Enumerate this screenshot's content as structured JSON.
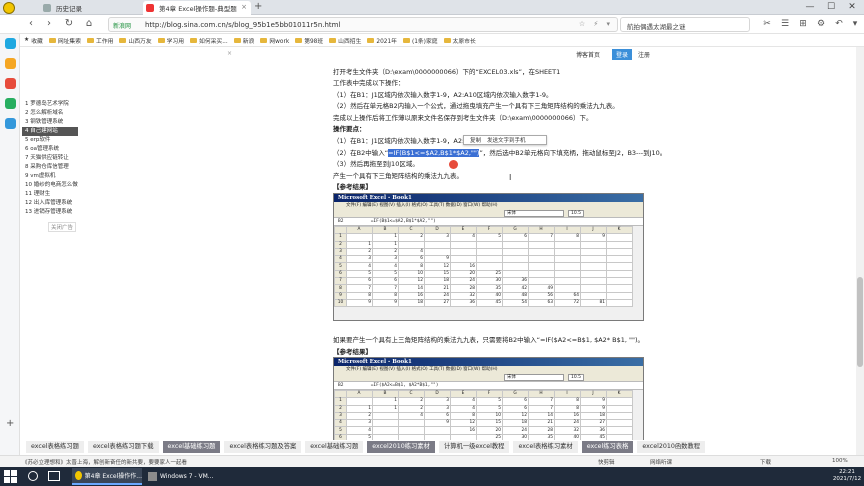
{
  "browser": {
    "tabs": [
      {
        "label": "历史记录",
        "active": false
      },
      {
        "label": "第4章 Excel操作题-典型题解析-...",
        "active": true
      }
    ],
    "new_tab": "+",
    "window_controls": {
      "minimize": "—",
      "maximize": "☐",
      "close": "✕"
    },
    "url": "http://blog.sina.com.cn/s/blog_95b1e5bb01011r5n.html",
    "security_label": "新浪网",
    "search_text": "航拍偶遇太湖最之谜",
    "bookmarks": [
      "收藏",
      "网址集索",
      "工作用",
      "山西万友",
      "学习用",
      "如何采买...",
      "新浪",
      "网work",
      "第98班",
      "山西招生",
      "2021年",
      "(1条)家庭",
      "太原市长"
    ]
  },
  "site_header": {
    "links": [
      "新浪首页",
      "登录",
      "注册"
    ],
    "right_link": "博客首页"
  },
  "sidebar": {
    "items": [
      "1 罗德岛艺术学院",
      "2 怎么解析域名",
      "3 钢铁管理系统",
      "4 自己建网站",
      "5 erp软件",
      "6 oa管理系统",
      "7 天猫供应链转让",
      "8 采购仓库信管理",
      "9 vm虚拟机",
      "10 婚纱的电商怎么做",
      "11 理财生",
      "12 出入库管理系统",
      "13 进销存管理系统"
    ],
    "selected_index": 3,
    "ad_label": "关闭广告"
  },
  "article": {
    "lines": [
      "打开考生文件夹（D:\\exam\\0000000066）下的“EXCEL03.xls”，在SHEET1",
      "工作表中完成以下操作：",
      "（1）在B1：J1区域内依次输入数字1-9，A2:A10区域内依次输入数字1-9。",
      "（2）然后在单元格B2内输入一个公式，通过拖曳填充产生一个具有下三角矩阵结构的乘法九九表。",
      "完成以上操作后将工作薄以原来文件名保存到考生文件夹（D:\\exam\\0000000066）下。",
      "操作要点：",
      "（1）在B1：J1区域内依次输入数字1-9，A2:A10区",
      "（2）在B2中输入“",
      "=IF(B$1<=$A2,B$1*$A2,\"\")",
      "”，然后选中B2单元格向下填充柄，拖动鼠标至J2，B3---到J10。",
      "（3）然后再拖至到J10区域。",
      "产生一个具有下三角矩阵结构的乘法九九表。",
      "【参考结果】",
      "如果要产生一个具有上三角矩阵结构的乘法九九表，只需要将B2中输入“=IF($A2<=B$1, $A2* B$1, \"\")。",
      "【参考结果】"
    ],
    "popup": {
      "copy": "复制",
      "send": "发送文字到手机"
    }
  },
  "excel1": {
    "title": "Microsoft Excel - Book1",
    "menu": "文件(F) 编辑(E) 视图(V) 插入(I) 格式(O) 工具(T) 数据(D) 窗口(W) 帮助(H)",
    "cell_ref": "B2",
    "formula": "=IF(B$1<=$A2,B$1*$A2,\"\")",
    "font": "宋体",
    "font_size": "10.5",
    "columns": [
      "",
      "A",
      "B",
      "C",
      "D",
      "E",
      "F",
      "G",
      "H",
      "I",
      "J",
      "K"
    ],
    "rows": [
      [
        "1",
        "",
        "1",
        "2",
        "3",
        "4",
        "5",
        "6",
        "7",
        "8",
        "9",
        ""
      ],
      [
        "2",
        "1",
        "1",
        "",
        "",
        "",
        "",
        "",
        "",
        "",
        "",
        ""
      ],
      [
        "3",
        "2",
        "2",
        "4",
        "",
        "",
        "",
        "",
        "",
        "",
        "",
        ""
      ],
      [
        "4",
        "3",
        "3",
        "6",
        "9",
        "",
        "",
        "",
        "",
        "",
        "",
        ""
      ],
      [
        "5",
        "4",
        "4",
        "8",
        "12",
        "16",
        "",
        "",
        "",
        "",
        "",
        ""
      ],
      [
        "6",
        "5",
        "5",
        "10",
        "15",
        "20",
        "25",
        "",
        "",
        "",
        "",
        ""
      ],
      [
        "7",
        "6",
        "6",
        "12",
        "18",
        "24",
        "30",
        "36",
        "",
        "",
        "",
        ""
      ],
      [
        "8",
        "7",
        "7",
        "14",
        "21",
        "28",
        "35",
        "42",
        "49",
        "",
        "",
        ""
      ],
      [
        "9",
        "8",
        "8",
        "16",
        "24",
        "32",
        "40",
        "48",
        "56",
        "64",
        "",
        ""
      ],
      [
        "10",
        "9",
        "9",
        "18",
        "27",
        "36",
        "45",
        "54",
        "63",
        "72",
        "81",
        ""
      ]
    ]
  },
  "excel2": {
    "title": "Microsoft Excel - Book1",
    "menu": "文件(F) 编辑(E) 视图(V) 插入(I) 格式(O) 工具(T) 数据(D) 窗口(W) 帮助(H)",
    "cell_ref": "B2",
    "formula": "=IF($A2<=B$1, $A2*B$1,\"\")",
    "font": "宋体",
    "font_size": "10.5",
    "columns": [
      "",
      "A",
      "B",
      "C",
      "D",
      "E",
      "F",
      "G",
      "H",
      "I",
      "J",
      "K"
    ],
    "rows": [
      [
        "1",
        "",
        "1",
        "2",
        "3",
        "4",
        "5",
        "6",
        "7",
        "8",
        "9",
        ""
      ],
      [
        "2",
        "1",
        "1",
        "2",
        "3",
        "4",
        "5",
        "6",
        "7",
        "8",
        "9",
        ""
      ],
      [
        "3",
        "2",
        "",
        "4",
        "6",
        "8",
        "10",
        "12",
        "14",
        "16",
        "18",
        ""
      ],
      [
        "4",
        "3",
        "",
        "",
        "9",
        "12",
        "15",
        "18",
        "21",
        "24",
        "27",
        ""
      ],
      [
        "5",
        "4",
        "",
        "",
        "",
        "16",
        "20",
        "24",
        "28",
        "32",
        "36",
        ""
      ],
      [
        "6",
        "5",
        "",
        "",
        "",
        "",
        "25",
        "30",
        "35",
        "40",
        "45",
        ""
      ]
    ]
  },
  "related": [
    {
      "label": "excel表格练习题",
      "style": "light"
    },
    {
      "label": "excel表格练习题下载",
      "style": "light"
    },
    {
      "label": "excel基础练习题",
      "style": "dark"
    },
    {
      "label": "excel表格练习题及答案",
      "style": "light"
    },
    {
      "label": "excel基础练习题",
      "style": "light"
    },
    {
      "label": "excel2010练习素材",
      "style": "dark"
    },
    {
      "label": "计算机一级excel教程",
      "style": "light"
    },
    {
      "label": "excel表格练习素材",
      "style": "light"
    },
    {
      "label": "excel练习表格",
      "style": "dark"
    },
    {
      "label": "excel2010函数教程",
      "style": "light"
    }
  ],
  "status": {
    "left": "《苏必立理想和》太晋上海，解创新奋任的新共要，要要家人一起看",
    "right": [
      "快剪辑",
      "网络听课",
      "下载",
      "100%"
    ]
  },
  "taskbar": {
    "apps": [
      {
        "label": "第4章 Excel操作作...",
        "active": true
      },
      {
        "label": "Windows 7 - VM...",
        "active": false
      }
    ],
    "time": "22:21",
    "date": "2021/7/12"
  },
  "colors": {
    "accent": "#3b6fd4",
    "taskbar": "#1f2a3a",
    "related_dark": "#7b7b86"
  }
}
